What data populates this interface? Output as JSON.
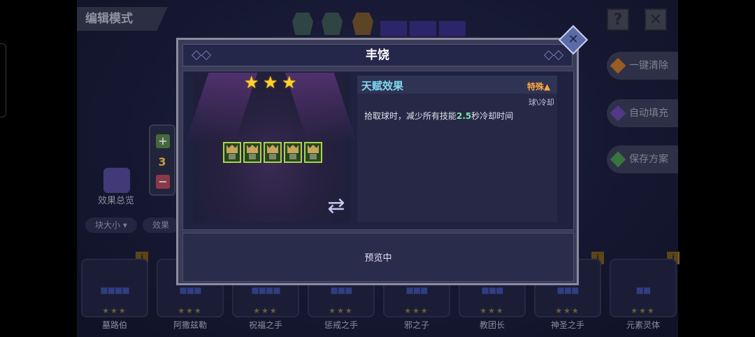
{
  "header": {
    "mode_title": "编辑模式",
    "help_icon": "question-icon",
    "close_icon": "close-icon"
  },
  "side_buttons": [
    {
      "label": "一键清除",
      "color": "#c87a2a"
    },
    {
      "label": "自动填充",
      "color": "#6a4ab0"
    },
    {
      "label": "保存方案",
      "color": "#4a9a4a"
    }
  ],
  "stepper": {
    "plus": "+",
    "value": "3",
    "minus": "−"
  },
  "overview": {
    "label": "效果总览"
  },
  "filters": [
    "块大小 ▾",
    "效果"
  ],
  "cards": [
    {
      "name": "墓路伯",
      "blocks": "■■■■",
      "stars": "★★★"
    },
    {
      "name": "阿撒兹勒",
      "blocks": "■■■",
      "stars": "★★★"
    },
    {
      "name": "祝福之手",
      "blocks": "■■■■",
      "stars": "★★★"
    },
    {
      "name": "惩戒之手",
      "blocks": "■■■",
      "stars": "★★★"
    },
    {
      "name": "邪之子",
      "blocks": "■■■",
      "stars": "★★★"
    },
    {
      "name": "教团长",
      "blocks": "■■■",
      "stars": "★★★"
    },
    {
      "name": "神圣之手",
      "blocks": "■■■",
      "stars": "★★★"
    },
    {
      "name": "元素灵体",
      "blocks": "■■",
      "stars": "★★★"
    }
  ],
  "modal": {
    "title": "丰饶",
    "stars": [
      "★",
      "★",
      "★"
    ],
    "unit_count": 5,
    "talent": {
      "title": "天赋效果",
      "tag": "特殊▲",
      "subtag": "球\\冷却",
      "desc_before": "拾取球时，减少所有技能",
      "desc_value": "2.5",
      "desc_after": "秒冷却时间"
    },
    "status": "预览中",
    "swap_icon": "swap-icon"
  }
}
